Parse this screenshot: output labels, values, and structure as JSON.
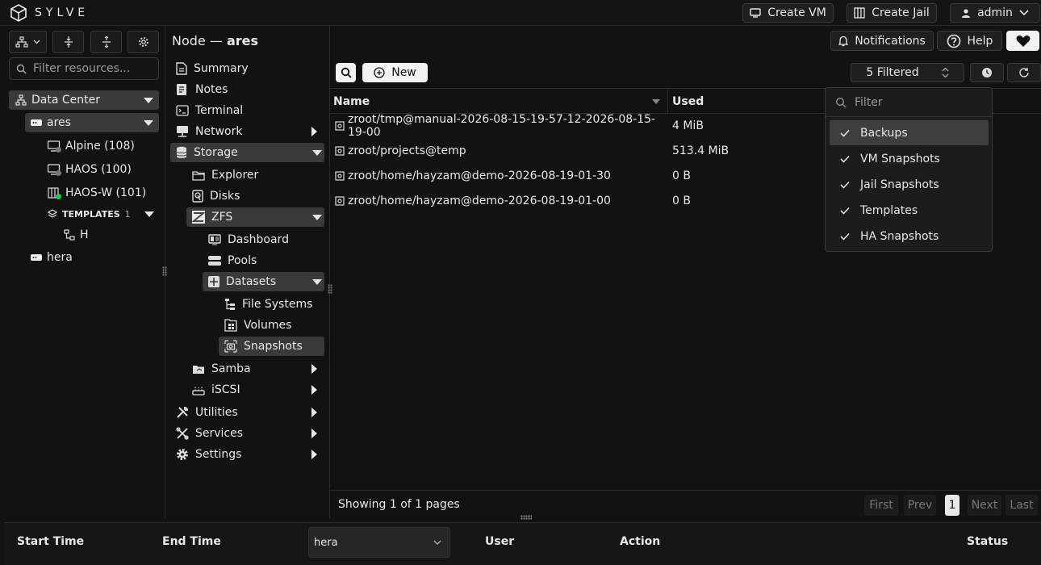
{
  "app": {
    "brand": "SYLVE"
  },
  "header": {
    "create_vm": "Create VM",
    "create_jail": "Create Jail",
    "user": "admin"
  },
  "node_header": {
    "prefix": "Node —",
    "name": "ares",
    "notifications": "Notifications",
    "help": "Help"
  },
  "tree": {
    "search_placeholder": "Filter resources...",
    "data_center": "Data Center",
    "ares": "ares",
    "items": [
      {
        "label": "Alpine (108)",
        "status": "stopped"
      },
      {
        "label": "HAOS (100)",
        "status": "stopped"
      },
      {
        "label": "HAOS-W (101)",
        "status": "running"
      }
    ],
    "templates_label": "TEMPLATES",
    "templates_count": "1",
    "template_item": "H",
    "hera": "hera"
  },
  "nav": {
    "summary": "Summary",
    "notes": "Notes",
    "terminal": "Terminal",
    "network": "Network",
    "storage": "Storage",
    "explorer": "Explorer",
    "disks": "Disks",
    "zfs": "ZFS",
    "dashboard": "Dashboard",
    "pools": "Pools",
    "datasets": "Datasets",
    "file_systems": "File Systems",
    "volumes": "Volumes",
    "snapshots": "Snapshots",
    "samba": "Samba",
    "iscsi": "iSCSI",
    "utilities": "Utilities",
    "services": "Services",
    "settings": "Settings"
  },
  "toolbar": {
    "new_label": "New",
    "filter_label": "5 Filtered"
  },
  "table": {
    "columns": [
      "Name",
      "Used"
    ],
    "rows": [
      {
        "name": "zroot/tmp@manual-2026-08-15-19-57-12-2026-08-15-19-00",
        "used": "4 MiB"
      },
      {
        "name": "zroot/projects@temp",
        "used": "513.4 MiB"
      },
      {
        "name": "zroot/home/hayzam@demo-2026-08-19-01-30",
        "used": "0 B"
      },
      {
        "name": "zroot/home/hayzam@demo-2026-08-19-01-00",
        "used": "0 B"
      }
    ]
  },
  "filter_dropdown": {
    "placeholder": "Filter",
    "options": [
      "Backups",
      "VM Snapshots",
      "Jail Snapshots",
      "Templates",
      "HA Snapshots"
    ]
  },
  "pagination": {
    "status": "Showing 1 of 1 pages",
    "first": "First",
    "prev": "Prev",
    "page": "1",
    "next": "Next",
    "last": "Last"
  },
  "tasks": {
    "start_time": "Start Time",
    "end_time": "End Time",
    "node_select": "hera",
    "user": "User",
    "action": "Action",
    "status": "Status"
  }
}
